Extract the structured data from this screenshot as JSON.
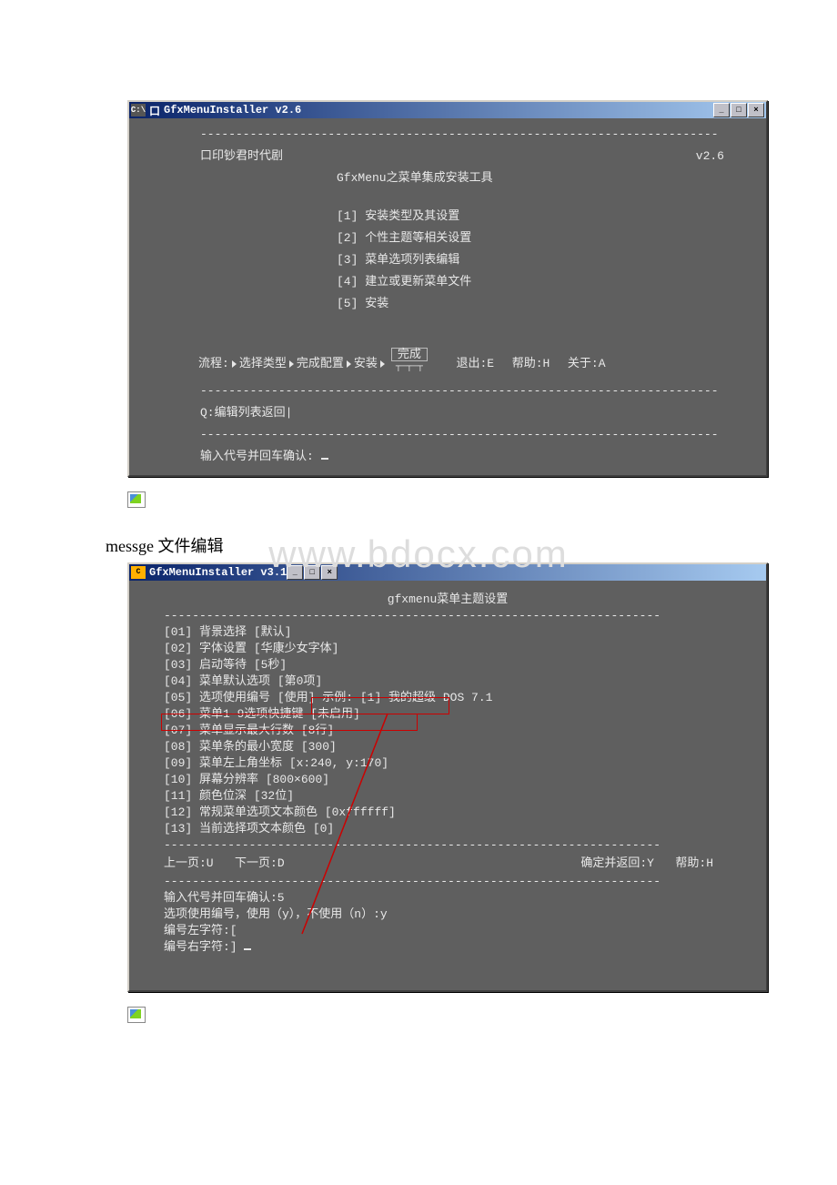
{
  "watermark": "www.bdocx.com",
  "win1": {
    "title_prefix": "C:\\",
    "title": "GfxMenuInstaller v2.6",
    "dashline": "-------------------------------------------------------------------------",
    "header_left": "口印钞君时代剧",
    "header_right": "v2.6",
    "subtitle": "GfxMenu之菜单集成安装工具",
    "menu": [
      {
        "num": "[1]",
        "label": "安装类型及其设置"
      },
      {
        "num": "[2]",
        "label": "个性主题等相关设置"
      },
      {
        "num": "[3]",
        "label": "菜单选项列表编辑"
      },
      {
        "num": "[4]",
        "label": "建立或更新菜单文件"
      },
      {
        "num": "[5]",
        "label": "安装"
      }
    ],
    "flow_label": "流程:",
    "flow_sel": "选择类型",
    "flow_cfg": "完成配置",
    "flow_inst": "安装",
    "complete": "完成",
    "exit": "退出:E",
    "help": "帮助:H",
    "about": "关于:A",
    "back": "Q:编辑列表返回|",
    "prompt": "输入代号并回车确认:"
  },
  "section2_label": "messge 文件编辑",
  "win2": {
    "title": "GfxMenuInstaller v3.1",
    "heading": "gfxmenu菜单主题设置",
    "dashline": "----------------------------------------------------------------------",
    "items": [
      {
        "n": "[01]",
        "t": "背景选择 [默认]"
      },
      {
        "n": "[02]",
        "t": "字体设置 [华康少女字体]"
      },
      {
        "n": "[03]",
        "t": "启动等待 [5秒]"
      },
      {
        "n": "[04]",
        "t": "菜单默认选项 [第0项]"
      },
      {
        "n": "[05]",
        "t": "选项使用编号 [使用] 示例: [1] 我的超级 DOS 7.1"
      },
      {
        "n": "[06]",
        "t": "菜单1-9选项快捷键 [未启用]"
      },
      {
        "n": "[07]",
        "t": "菜单显示最大行数 [8行]"
      },
      {
        "n": "[08]",
        "t": "菜单条的最小宽度 [300]"
      },
      {
        "n": "[09]",
        "t": "菜单左上角坐标 [x:240, y:170]"
      },
      {
        "n": "[10]",
        "t": "屏幕分辨率 [800×600]"
      },
      {
        "n": "[11]",
        "t": "颜色位深 [32位]"
      },
      {
        "n": "[12]",
        "t": "常规菜单选项文本颜色 [0xffffff]"
      },
      {
        "n": "[13]",
        "t": "当前选择项文本颜色 [0]"
      }
    ],
    "nav_prev": "上一页:U",
    "nav_next": "下一页:D",
    "nav_ok": "确定并返回:Y",
    "nav_help": "帮助:H",
    "p1": "输入代号并回车确认:5",
    "p2": "选项使用编号，使用（y），不使用（n）:y",
    "p3": "编号左字符:[",
    "p4": "编号右字符:]"
  }
}
